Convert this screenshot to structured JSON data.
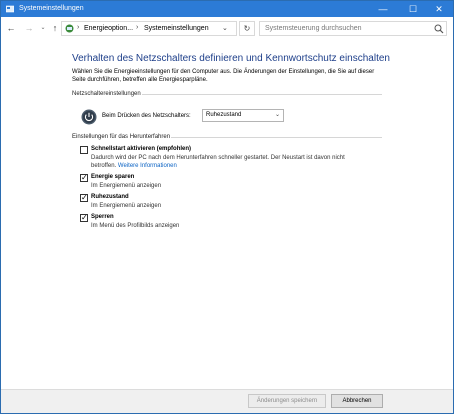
{
  "window": {
    "title": "Systemeinstellungen",
    "controls": {
      "minimize": "—",
      "maximize": "☐",
      "close": "✕"
    }
  },
  "addressbar": {
    "breadcrumbs": [
      "Energieoption...",
      "Systemeinstellungen"
    ],
    "search_placeholder": "Systemsteuerung durchsuchen"
  },
  "main": {
    "title": "Verhalten des Netzschalters definieren und Kennwortschutz einschalten",
    "intro": "Wählen Sie die Energieeinstellungen für den Computer aus. Die Änderungen der Einstellungen, die Sie auf dieser Seite durchführen, betreffen alle Energiesparpläne.",
    "power_section": {
      "header": "Netzschaltereinstellungen",
      "label": "Beim Drücken des Netzschalters:",
      "selected": "Ruhezustand"
    },
    "shutdown_section": {
      "header": "Einstellungen für das Herunterfahren",
      "options": [
        {
          "label": "Schnellstart aktivieren (empfohlen)",
          "checked": false,
          "desc_line1": "Dadurch wird der PC nach dem Herunterfahren schneller gestartet. Der Neustart ist davon nicht",
          "desc_line2": "betroffen.",
          "link": "Weitere Informationen"
        },
        {
          "label": "Energie sparen",
          "checked": true,
          "desc": "Im Energiemenü anzeigen"
        },
        {
          "label": "Ruhezustand",
          "checked": true,
          "desc": "Im Energiemenü anzeigen"
        },
        {
          "label": "Sperren",
          "checked": true,
          "desc": "Im Menü des Profilbilds anzeigen"
        }
      ]
    }
  },
  "footer": {
    "save": "Änderungen speichern",
    "cancel": "Abbrechen"
  },
  "colors": {
    "titlebar": "#2c7bd6",
    "heading": "#1e3f8a",
    "link": "#0b63c4"
  }
}
